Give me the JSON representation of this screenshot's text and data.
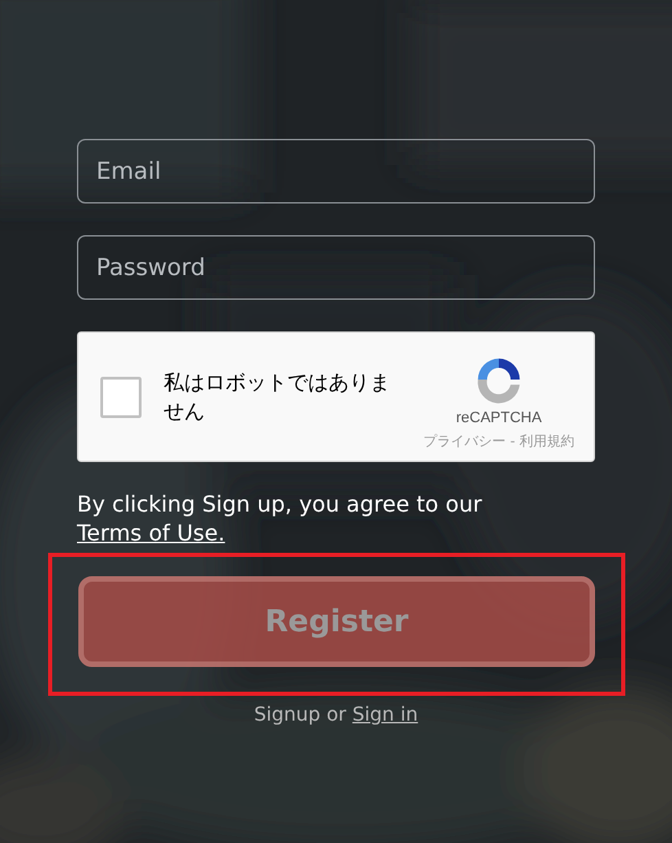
{
  "form": {
    "email": {
      "placeholder": "Email"
    },
    "password": {
      "placeholder": "Password"
    }
  },
  "captcha": {
    "checked": false,
    "label": "私はロボットではありません",
    "brand": "reCAPTCHA",
    "links": "プライバシー - 利用規約"
  },
  "terms": {
    "text": "By clicking Sign up, you agree to our",
    "link": "Terms of Use."
  },
  "register_button": {
    "label": "Register",
    "disabled": true,
    "highlighted": true
  },
  "footer": {
    "text": "Signup or",
    "link": "Sign in"
  }
}
